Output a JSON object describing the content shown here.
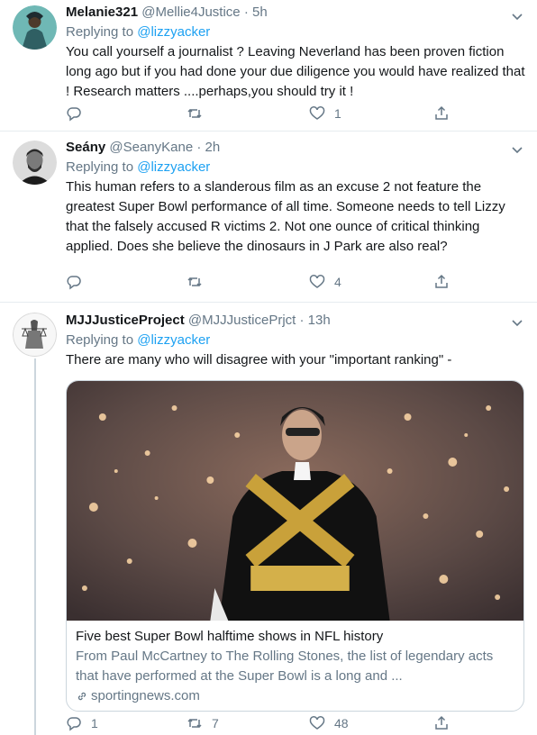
{
  "tweets": [
    {
      "name": "Melanie321",
      "handle": "@Mellie4Justice",
      "sep": "·",
      "time": "5h",
      "reply_prefix": "Replying to",
      "reply_to": "@lizzyacker",
      "text": "You call yourself a journalist ? Leaving Neverland has been proven fiction long ago but if you had done your due diligence you would have realized that ! Research matters ....perhaps,you should try it !",
      "reply_count": "",
      "retweet_count": "",
      "like_count": "1"
    },
    {
      "name": "Seány",
      "handle": "@SeanyKane",
      "sep": "·",
      "time": "2h",
      "reply_prefix": "Replying to",
      "reply_to": "@lizzyacker",
      "text": "This human refers to a slanderous film as an excuse 2 not feature the greatest Super Bowl performance of all time. Someone needs to tell Lizzy that the falsely accused R victims 2. Not one ounce of critical thinking applied. Does she believe the dinosaurs in J Park are also real?",
      "reply_count": "",
      "retweet_count": "",
      "like_count": "4"
    },
    {
      "name": "MJJJusticeProject",
      "handle": "@MJJJusticePrjct",
      "sep": "·",
      "time": "13h",
      "reply_prefix": "Replying to",
      "reply_to": "@lizzyacker",
      "text": "There are many who will disagree with your \"important ranking\"  -",
      "card": {
        "title": "Five best Super Bowl halftime shows in NFL history",
        "description": "From Paul McCartney to The Rolling Stones, the list of legendary acts that have performed at the Super Bowl is a long and ...",
        "domain": "sportingnews.com"
      },
      "reply_count": "1",
      "retweet_count": "7",
      "like_count": "48"
    }
  ],
  "colors": {
    "accent": "#1da1f2",
    "secondary_text": "#657786",
    "border": "#e6ecf0"
  },
  "icons": [
    "chevron-down-icon",
    "reply-icon",
    "retweet-icon",
    "like-icon",
    "share-icon",
    "link-icon"
  ]
}
